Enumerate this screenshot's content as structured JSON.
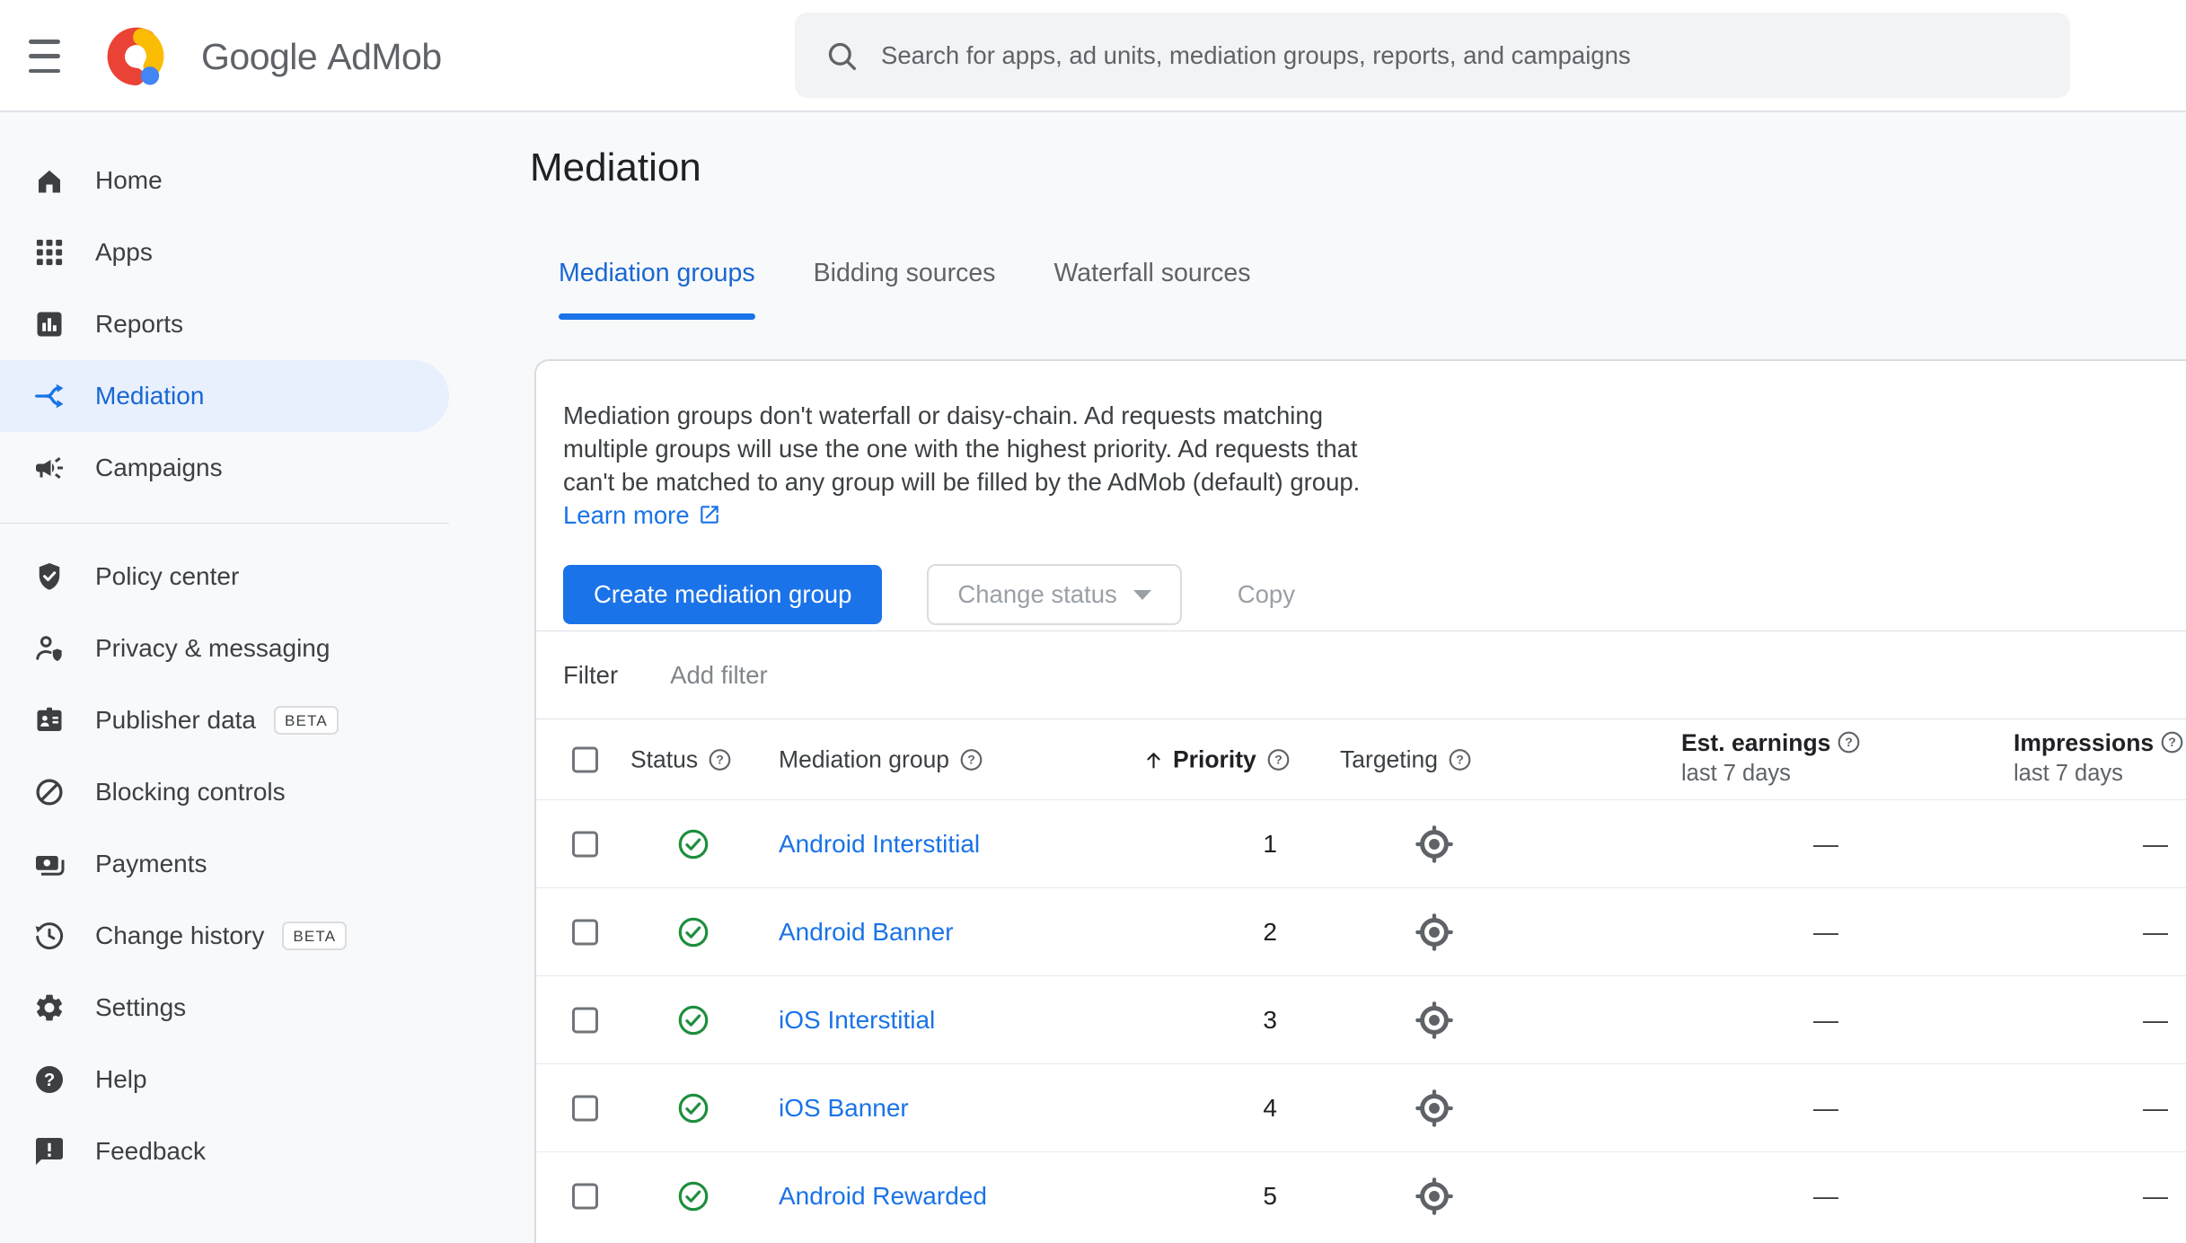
{
  "header": {
    "brand_google": "Google",
    "brand_admob": "AdMob",
    "search_placeholder": "Search for apps, ad units, mediation groups, reports, and campaigns"
  },
  "sidebar": {
    "main_items": [
      {
        "label": "Home",
        "icon": "home"
      },
      {
        "label": "Apps",
        "icon": "apps-grid"
      },
      {
        "label": "Reports",
        "icon": "bar-chart"
      },
      {
        "label": "Mediation",
        "icon": "mediation-split-arrows",
        "active": true
      },
      {
        "label": "Campaigns",
        "icon": "megaphone"
      }
    ],
    "secondary_items": [
      {
        "label": "Policy center",
        "icon": "shield-check"
      },
      {
        "label": "Privacy & messaging",
        "icon": "person-shield"
      },
      {
        "label": "Publisher data",
        "icon": "id-badge",
        "badge": "BETA"
      },
      {
        "label": "Blocking controls",
        "icon": "block-circle"
      },
      {
        "label": "Payments",
        "icon": "banknote"
      },
      {
        "label": "Change history",
        "icon": "history-clock",
        "badge": "BETA"
      },
      {
        "label": "Settings",
        "icon": "gear"
      },
      {
        "label": "Help",
        "icon": "question-circle"
      },
      {
        "label": "Feedback",
        "icon": "feedback-bubble"
      }
    ]
  },
  "main": {
    "page_title": "Mediation",
    "tabs": [
      {
        "label": "Mediation groups",
        "active": true
      },
      {
        "label": "Bidding sources",
        "active": false
      },
      {
        "label": "Waterfall sources",
        "active": false
      }
    ],
    "card": {
      "description": "Mediation groups don't waterfall or daisy-chain. Ad requests matching multiple groups will use the one with the highest priority. Ad requests that can't be matched to any group will be filled by the AdMob (default) group.",
      "learn_more": "Learn more",
      "buttons": {
        "create": "Create mediation group",
        "change_status": "Change status",
        "copy": "Copy"
      },
      "filter": {
        "label": "Filter",
        "add_filter": "Add filter"
      },
      "table": {
        "columns": {
          "status": "Status",
          "mediation_group": "Mediation group",
          "priority": "Priority",
          "targeting": "Targeting",
          "est_earnings": "Est. earnings",
          "impressions": "Impressions",
          "period": "last 7 days"
        },
        "rows": [
          {
            "status": "active",
            "name": "Android Interstitial",
            "priority": "1",
            "est_earnings": "—",
            "impressions": "—"
          },
          {
            "status": "active",
            "name": "Android Banner",
            "priority": "2",
            "est_earnings": "—",
            "impressions": "—"
          },
          {
            "status": "active",
            "name": "iOS Interstitial",
            "priority": "3",
            "est_earnings": "—",
            "impressions": "—"
          },
          {
            "status": "active",
            "name": "iOS Banner",
            "priority": "4",
            "est_earnings": "—",
            "impressions": "—"
          },
          {
            "status": "active",
            "name": "Android Rewarded",
            "priority": "5",
            "est_earnings": "—",
            "impressions": "—"
          }
        ]
      }
    }
  },
  "colors": {
    "accent_blue": "#1a73e8",
    "active_nav_blue": "#1967d2",
    "active_nav_bg": "#e8f0fe",
    "success_green": "#1e8e3e",
    "text_primary": "#202124",
    "text_secondary": "#5f6368",
    "disabled_text": "#9aa0a6",
    "border": "#dadce0",
    "surface": "#ffffff",
    "background": "#f8f9fa",
    "search_bg": "#f1f3f4"
  }
}
